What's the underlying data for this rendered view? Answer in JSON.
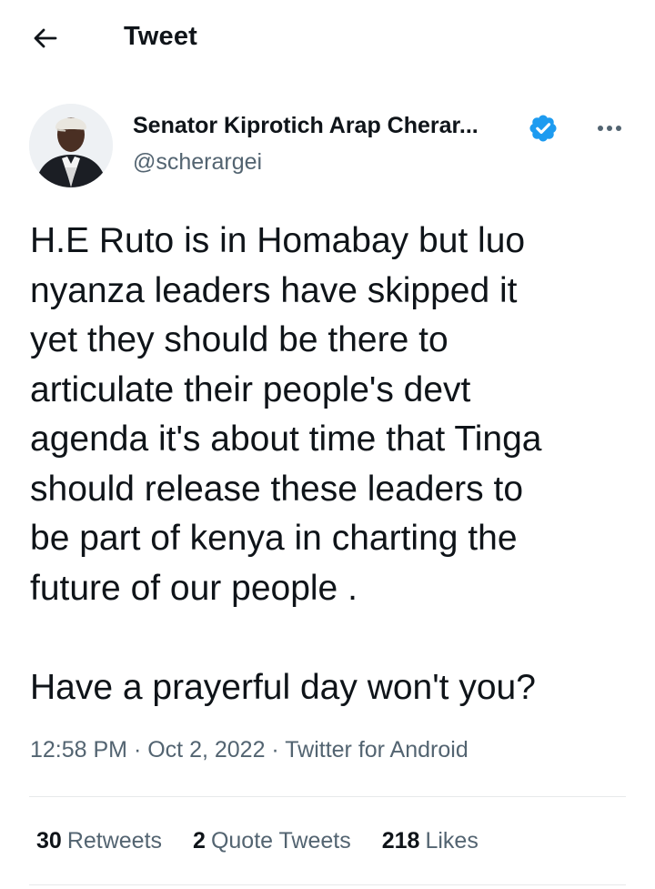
{
  "header": {
    "title": "Tweet"
  },
  "author": {
    "name": "Senator Kiprotich Arap Cherar...",
    "handle": "@scherargei",
    "verified": true
  },
  "tweet": {
    "text": "H.E Ruto is in Homabay but luo\nnyanza leaders have skipped it\nyet they should be there to\narticulate their people's devt\nagenda it's about time that Tinga\nshould release these leaders to\nbe part of kenya in charting the\nfuture of our people .\n\nHave a prayerful day won't you?",
    "time": "12:58 PM",
    "date": "Oct 2, 2022",
    "source": "Twitter for Android"
  },
  "stats": {
    "retweets_count": "30",
    "retweets_label": "Retweets",
    "quotes_count": "2",
    "quotes_label": "Quote Tweets",
    "likes_count": "218",
    "likes_label": "Likes"
  },
  "colors": {
    "text": "#0f1419",
    "secondary": "#536471",
    "verified": "#1d9bf0",
    "divider": "#e7e9ea"
  },
  "icons": [
    "back-arrow-icon",
    "verified-badge-icon",
    "more-options-icon"
  ]
}
